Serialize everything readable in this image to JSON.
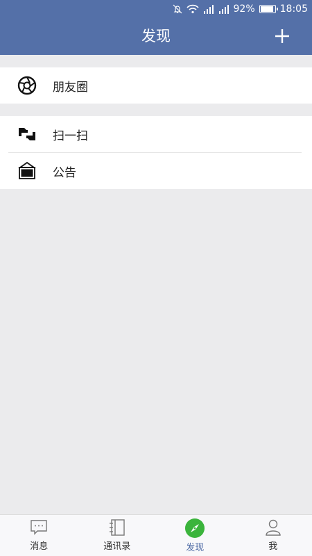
{
  "status_bar": {
    "battery": "92%",
    "time": "18:05",
    "battery_level": 0.92,
    "icons": [
      "mute-icon",
      "wifi-icon",
      "signal-icon",
      "signal-icon",
      "battery-icon"
    ]
  },
  "header": {
    "title": "发现",
    "add_icon": "plus-icon",
    "background": "#5470a8"
  },
  "groups": [
    {
      "items": [
        {
          "label": "朋友圈",
          "icon": "moments-aperture-icon"
        }
      ]
    },
    {
      "items": [
        {
          "label": "扫一扫",
          "icon": "scan-icon"
        },
        {
          "label": "公告",
          "icon": "announcement-icon"
        }
      ]
    }
  ],
  "tabbar": {
    "tabs": [
      {
        "label": "消息",
        "icon": "chat-bubble-icon",
        "active": false
      },
      {
        "label": "通讯录",
        "icon": "contacts-book-icon",
        "active": false
      },
      {
        "label": "发现",
        "icon": "compass-icon",
        "active": true
      },
      {
        "label": "我",
        "icon": "person-icon",
        "active": false
      }
    ],
    "active_color": "#3bb43c"
  }
}
